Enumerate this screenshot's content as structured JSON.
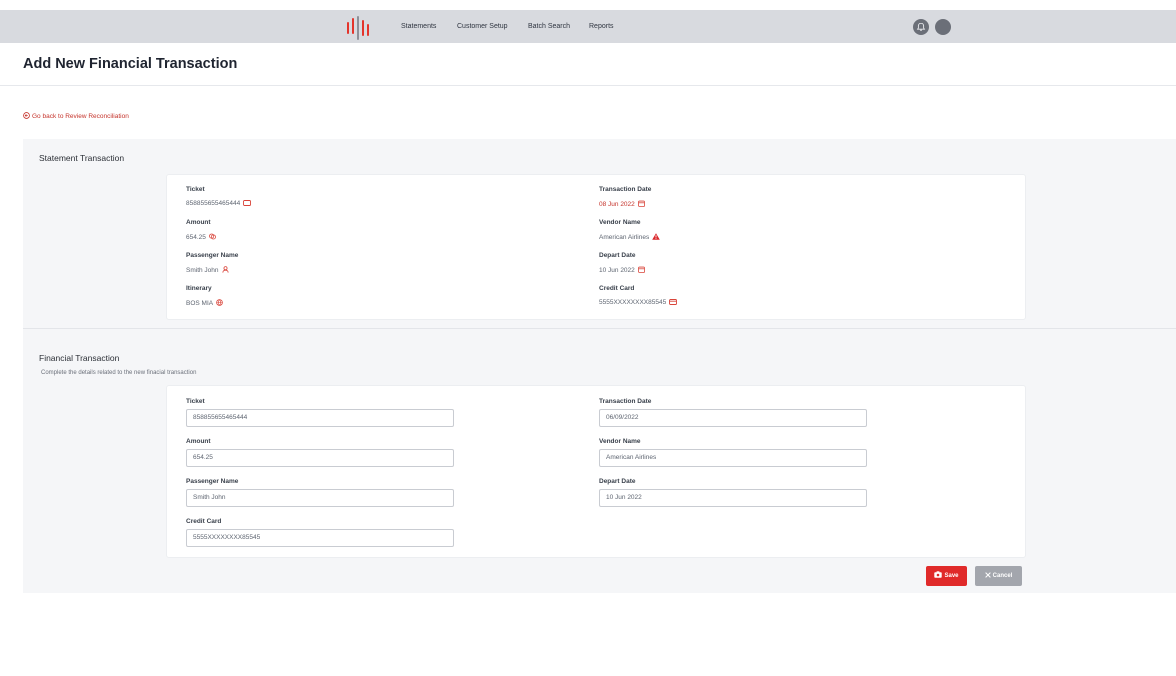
{
  "header": {
    "logo": "company-logo",
    "nav": [
      "Statements",
      "Customer Setup",
      "Batch Search",
      "Reports"
    ],
    "icons": [
      "bell-icon",
      "profile-icon"
    ]
  },
  "page": {
    "title": "Add New Financial Transaction",
    "back_link": "Go back to Review Reconciliation"
  },
  "statement": {
    "title": "Statement Transaction",
    "fields": {
      "ticket": {
        "label": "Ticket",
        "value": "858855655465444",
        "icon": "ticket-icon"
      },
      "amount": {
        "label": "Amount",
        "value": "654.25",
        "icon": "coins-icon"
      },
      "passenger": {
        "label": "Passenger Name",
        "value": "Smith John",
        "icon": "user-icon"
      },
      "itinerary": {
        "label": "Itinerary",
        "value": "BOS MIA",
        "icon": "globe-icon"
      },
      "transaction_date": {
        "label": "Transaction Date",
        "value": "08 Jun 2022",
        "icon": "calendar-icon"
      },
      "vendor": {
        "label": "Vendor Name",
        "value": "American Airlines",
        "icon": "warning-icon"
      },
      "depart_date": {
        "label": "Depart Date",
        "value": "10 Jun 2022",
        "icon": "calendar-icon"
      },
      "credit_card": {
        "label": "Credit Card",
        "value": "5555XXXXXXXX85545",
        "icon": "credit-card-icon"
      }
    }
  },
  "financial": {
    "title": "Financial Transaction",
    "subtitle": "Complete the details related to the new finacial transaction",
    "fields": {
      "ticket": {
        "label": "Ticket",
        "value": "858855655465444"
      },
      "amount": {
        "label": "Amount",
        "value": "654.25"
      },
      "passenger": {
        "label": "Passenger Name",
        "value": "Smith John"
      },
      "credit_card": {
        "label": "Credit Card",
        "value": "5555XXXXXXXX85545"
      },
      "transaction_date": {
        "label": "Transaction Date",
        "value": "06/09/2022"
      },
      "vendor": {
        "label": "Vendor Name",
        "value": "American Airlines"
      },
      "depart_date": {
        "label": "Depart Date",
        "value": "10 Jun 2022"
      }
    }
  },
  "actions": {
    "save": "Save",
    "cancel": "Cancel"
  },
  "colors": {
    "accent": "#e02a2a",
    "topbar": "#d8dadf",
    "panel": "#f5f6f8",
    "cancel": "#a3a6ad"
  }
}
